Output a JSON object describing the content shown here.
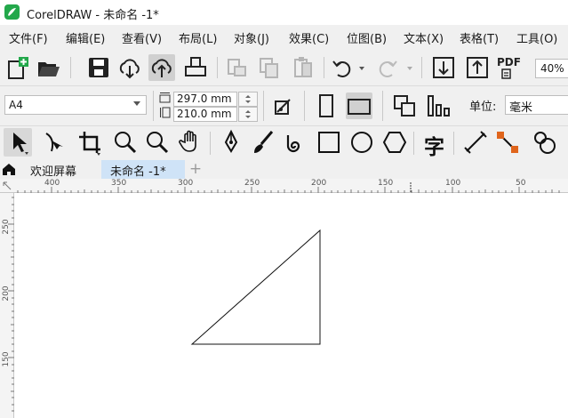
{
  "window": {
    "title": "CorelDRAW - 未命名 -1*"
  },
  "menu": {
    "items": [
      "文件(F)",
      "编辑(E)",
      "查看(V)",
      "布局(L)",
      "对象(J)",
      "效果(C)",
      "位图(B)",
      "文本(X)",
      "表格(T)",
      "工具(O)"
    ]
  },
  "toolbar": {
    "buttons": [
      "new-document",
      "open",
      "save",
      "download-from-cloud",
      "upload-to-cloud",
      "print",
      "cut",
      "copy",
      "paste",
      "undo",
      "redo",
      "import",
      "export",
      "publish-to-pdf"
    ],
    "pdf_label": "PDF",
    "zoom_value": "40%"
  },
  "property_bar": {
    "paper_size": "A4",
    "width_value": "297.0 mm",
    "height_value": "210.0 mm",
    "units_label": "单位:",
    "units_value": "毫米"
  },
  "toolbox": {
    "tools": [
      "pick-tool",
      "shape-tool",
      "crop-tool",
      "zoom-tool",
      "zoom-tool-2",
      "pan-tool",
      "pen-tool",
      "artistic-media-tool",
      "spiral-tool",
      "rectangle-tool",
      "ellipse-tool",
      "polygon-tool",
      "text-tool",
      "dimension-tool",
      "connector-tool",
      "blend-tool"
    ],
    "text_tool_glyph": "字"
  },
  "tabs": {
    "welcome": "欢迎屏幕",
    "document": "未命名 -1*",
    "add": "+"
  },
  "rulers": {
    "horizontal_labels": [
      "400",
      "350",
      "300",
      "250",
      "200",
      "150",
      "100",
      "50"
    ],
    "vertical_labels": [
      "250",
      "200",
      "150"
    ]
  },
  "colors": {
    "brand_green": "#23a84b",
    "active_tab": "#cfe3f7",
    "connector_accent": "#e0651c"
  }
}
